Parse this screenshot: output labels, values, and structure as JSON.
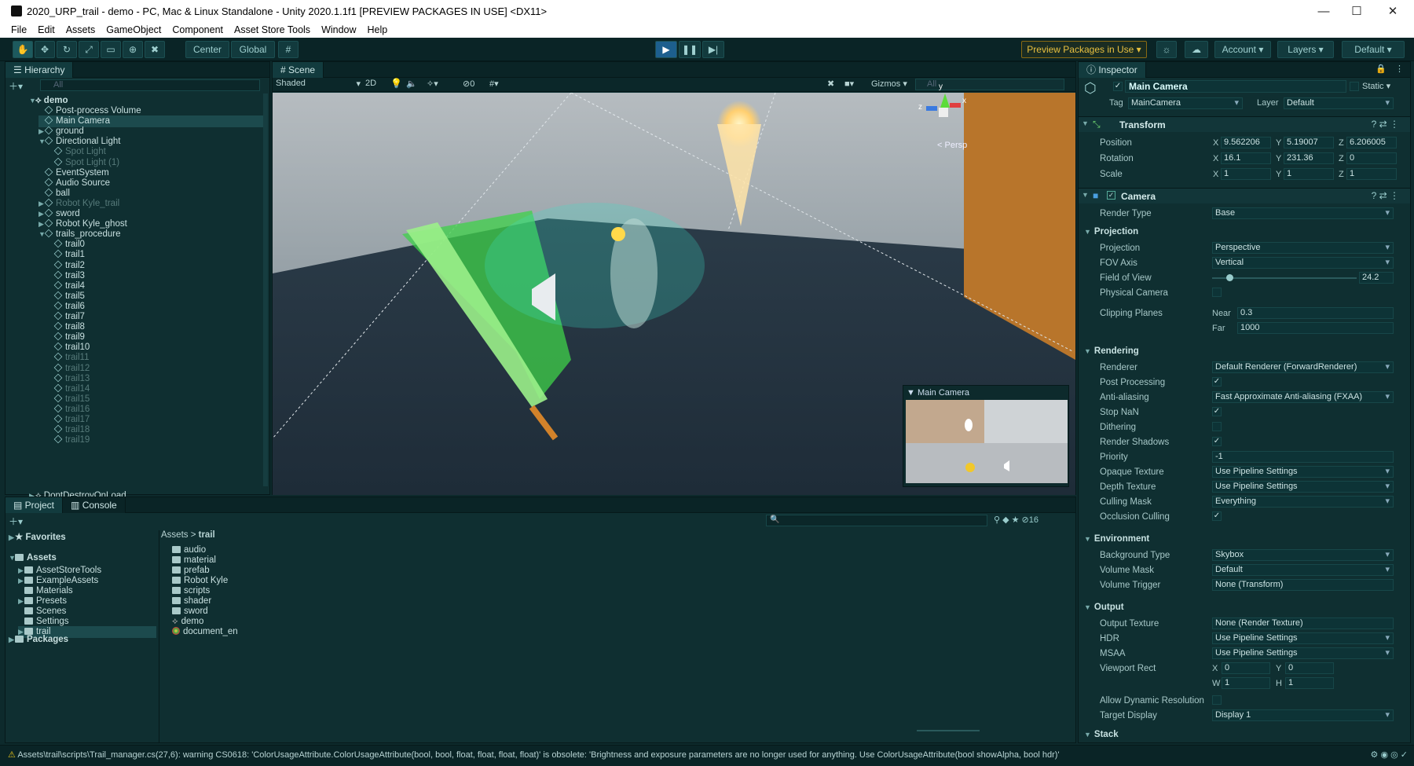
{
  "window": {
    "title": "2020_URP_trail - demo - PC, Mac & Linux Standalone - Unity 2020.1.1f1 [PREVIEW PACKAGES IN USE] <DX11>",
    "minimize": "—",
    "maximize": "☐",
    "close": "✕"
  },
  "menu": [
    "File",
    "Edit",
    "Assets",
    "GameObject",
    "Component",
    "Asset Store Tools",
    "Window",
    "Help"
  ],
  "toolbar": {
    "center": "Center",
    "global": "Global",
    "preview_packages": "Preview Packages in Use",
    "account": "Account",
    "layers": "Layers",
    "layout": "Default"
  },
  "hierarchy": {
    "tab": "Hierarchy",
    "search_placeholder": "All",
    "scene": "demo",
    "items": [
      {
        "name": "Post-process Volume",
        "indent": 1,
        "dim": false,
        "arrow": ""
      },
      {
        "name": "Main Camera",
        "indent": 1,
        "dim": false,
        "arrow": "",
        "selected": true
      },
      {
        "name": "ground",
        "indent": 1,
        "dim": false,
        "arrow": "▶"
      },
      {
        "name": "Directional Light",
        "indent": 1,
        "dim": false,
        "arrow": "▼"
      },
      {
        "name": "Spot Light",
        "indent": 2,
        "dim": true,
        "arrow": ""
      },
      {
        "name": "Spot Light (1)",
        "indent": 2,
        "dim": true,
        "arrow": ""
      },
      {
        "name": "EventSystem",
        "indent": 1,
        "dim": false,
        "arrow": ""
      },
      {
        "name": "Audio Source",
        "indent": 1,
        "dim": false,
        "arrow": ""
      },
      {
        "name": "ball",
        "indent": 1,
        "dim": false,
        "arrow": ""
      },
      {
        "name": "Robot Kyle_trail",
        "indent": 1,
        "dim": true,
        "arrow": "▶"
      },
      {
        "name": "sword",
        "indent": 1,
        "dim": false,
        "arrow": "▶"
      },
      {
        "name": "Robot Kyle_ghost",
        "indent": 1,
        "dim": false,
        "arrow": "▶"
      },
      {
        "name": "trails_procedure",
        "indent": 1,
        "dim": false,
        "arrow": "▼"
      },
      {
        "name": "trail0",
        "indent": 2,
        "dim": false,
        "arrow": ""
      },
      {
        "name": "trail1",
        "indent": 2,
        "dim": false,
        "arrow": ""
      },
      {
        "name": "trail2",
        "indent": 2,
        "dim": false,
        "arrow": ""
      },
      {
        "name": "trail3",
        "indent": 2,
        "dim": false,
        "arrow": ""
      },
      {
        "name": "trail4",
        "indent": 2,
        "dim": false,
        "arrow": ""
      },
      {
        "name": "trail5",
        "indent": 2,
        "dim": false,
        "arrow": ""
      },
      {
        "name": "trail6",
        "indent": 2,
        "dim": false,
        "arrow": ""
      },
      {
        "name": "trail7",
        "indent": 2,
        "dim": false,
        "arrow": ""
      },
      {
        "name": "trail8",
        "indent": 2,
        "dim": false,
        "arrow": ""
      },
      {
        "name": "trail9",
        "indent": 2,
        "dim": false,
        "arrow": ""
      },
      {
        "name": "trail10",
        "indent": 2,
        "dim": false,
        "arrow": ""
      },
      {
        "name": "trail11",
        "indent": 2,
        "dim": true,
        "arrow": ""
      },
      {
        "name": "trail12",
        "indent": 2,
        "dim": true,
        "arrow": ""
      },
      {
        "name": "trail13",
        "indent": 2,
        "dim": true,
        "arrow": ""
      },
      {
        "name": "trail14",
        "indent": 2,
        "dim": true,
        "arrow": ""
      },
      {
        "name": "trail15",
        "indent": 2,
        "dim": true,
        "arrow": ""
      },
      {
        "name": "trail16",
        "indent": 2,
        "dim": true,
        "arrow": ""
      },
      {
        "name": "trail17",
        "indent": 2,
        "dim": true,
        "arrow": ""
      },
      {
        "name": "trail18",
        "indent": 2,
        "dim": true,
        "arrow": ""
      },
      {
        "name": "trail19",
        "indent": 2,
        "dim": true,
        "arrow": ""
      }
    ],
    "dontdestroy": "DontDestroyOnLoad"
  },
  "scene": {
    "tab": "Scene",
    "shading": "Shaded",
    "mode2d": "2D",
    "fx_count": "0",
    "gizmos": "Gizmos",
    "search_placeholder": "All",
    "persp": "Persp",
    "cam_preview_title": "Main Camera",
    "axis_y": "y",
    "axis_x": "x",
    "axis_z": "z"
  },
  "project": {
    "tab_project": "Project",
    "tab_console": "Console",
    "hidden_count": "16",
    "breadcrumb_root": "Assets",
    "breadcrumb_leaf": "trail",
    "favorites": "Favorites",
    "assets": "Assets",
    "packages": "Packages",
    "tree": [
      "AssetStoreTools",
      "ExampleAssets",
      "Materials",
      "Presets",
      "Scenes",
      "Settings",
      "trail"
    ],
    "files": [
      "audio",
      "material",
      "prefab",
      "Robot Kyle",
      "scripts",
      "shader",
      "sword",
      "demo",
      "document_en"
    ]
  },
  "status": {
    "message": "Assets\\trail\\scripts\\Trail_manager.cs(27,6): warning CS0618: 'ColorUsageAttribute.ColorUsageAttribute(bool, bool, float, float, float, float)' is obsolete: 'Brightness and exposure parameters are no longer used for anything. Use ColorUsageAttribute(bool showAlpha, bool hdr)'"
  },
  "inspector": {
    "tab": "Inspector",
    "object_name": "Main Camera",
    "static": "Static",
    "tag_label": "Tag",
    "tag": "MainCamera",
    "layer_label": "Layer",
    "layer": "Default",
    "transform": {
      "title": "Transform",
      "position_label": "Position",
      "rotation_label": "Rotation",
      "scale_label": "Scale",
      "pos": [
        "9.562206",
        "5.19007",
        "6.206005"
      ],
      "rot": [
        "16.1",
        "231.36",
        "0"
      ],
      "scl": [
        "1",
        "1",
        "1"
      ],
      "X": "X",
      "Y": "Y",
      "Z": "Z"
    },
    "camera": {
      "title": "Camera",
      "render_type_label": "Render Type",
      "render_type": "Base",
      "projection_head": "Projection",
      "projection_label": "Projection",
      "projection": "Perspective",
      "fov_axis_label": "FOV Axis",
      "fov_axis": "Vertical",
      "fov_label": "Field of View",
      "fov": "24.2",
      "fov_fraction": 0.12,
      "physical_label": "Physical Camera",
      "clipping_label": "Clipping Planes",
      "near_label": "Near",
      "near": "0.3",
      "far_label": "Far",
      "far": "1000",
      "rendering_head": "Rendering",
      "renderer_label": "Renderer",
      "renderer": "Default Renderer (ForwardRenderer)",
      "post_label": "Post Processing",
      "aa_label": "Anti-aliasing",
      "aa": "Fast Approximate Anti-aliasing (FXAA)",
      "stopnan_label": "Stop NaN",
      "dither_label": "Dithering",
      "shadows_label": "Render Shadows",
      "priority_label": "Priority",
      "priority": "-1",
      "opaque_label": "Opaque Texture",
      "opaque": "Use Pipeline Settings",
      "depth_label": "Depth Texture",
      "depth": "Use Pipeline Settings",
      "culling_label": "Culling Mask",
      "culling": "Everything",
      "occlusion_label": "Occlusion Culling",
      "env_head": "Environment",
      "bg_label": "Background Type",
      "bg": "Skybox",
      "volmask_label": "Volume Mask",
      "volmask": "Default",
      "voltrig_label": "Volume Trigger",
      "voltrig": "None (Transform)",
      "output_head": "Output",
      "outtex_label": "Output Texture",
      "outtex": "None (Render Texture)",
      "hdr_label": "HDR",
      "hdr": "Use Pipeline Settings",
      "msaa_label": "MSAA",
      "msaa": "Use Pipeline Settings",
      "viewport_label": "Viewport Rect",
      "vx": "0",
      "vy": "0",
      "vw": "1",
      "vh": "1",
      "W": "W",
      "H": "H",
      "dynres_label": "Allow Dynamic Resolution",
      "target_label": "Target Display",
      "target": "Display 1",
      "stack_head": "Stack",
      "check": "✓"
    }
  }
}
